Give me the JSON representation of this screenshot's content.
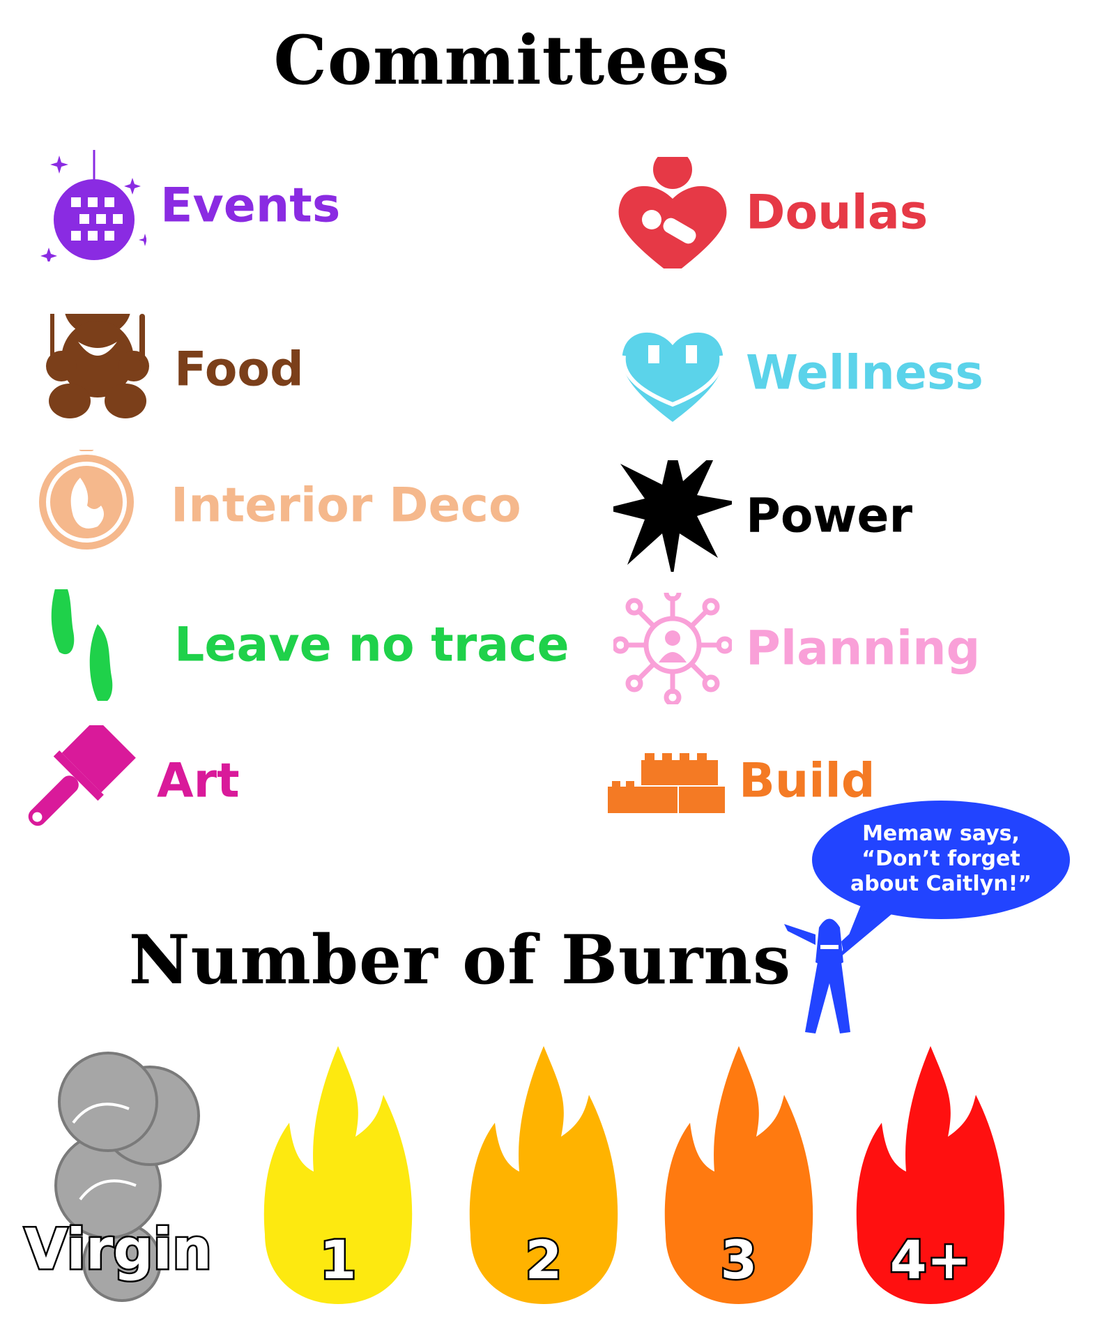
{
  "titles": {
    "committees": "Committees",
    "burns": "Number of Burns"
  },
  "committees": [
    {
      "label": "Events",
      "color": "#8a2be2",
      "icon": "disco-ball-icon"
    },
    {
      "label": "Doulas",
      "color": "#e63946",
      "icon": "heart-baby-icon"
    },
    {
      "label": "Food",
      "color": "#7b3f1a",
      "icon": "teddy-bear-icon"
    },
    {
      "label": "Wellness",
      "color": "#5bd3ea",
      "icon": "heart-mask-icon"
    },
    {
      "label": "Interior Deco",
      "color": "#f5b88c",
      "icon": "ornament-icon"
    },
    {
      "label": "Power",
      "color": "#000000",
      "icon": "burst-icon"
    },
    {
      "label": "Leave no trace",
      "color": "#1fd14a",
      "icon": "footprints-icon"
    },
    {
      "label": "Planning",
      "color": "#f9a0d8",
      "icon": "network-icon"
    },
    {
      "label": "Art",
      "color": "#d91a9a",
      "icon": "paintbrush-icon"
    },
    {
      "label": "Build",
      "color": "#f47a24",
      "icon": "bricks-icon"
    }
  ],
  "bubble": {
    "line1": "Memaw says,",
    "line2": "“Don’t forget",
    "line3": "about Caitlyn!”",
    "color": "#2244ff"
  },
  "burns": [
    {
      "label": "Virgin",
      "color": "#a6a6a6",
      "icon": "smoke-icon"
    },
    {
      "label": "1",
      "color": "#fde910",
      "icon": "flame-icon"
    },
    {
      "label": "2",
      "color": "#ffb300",
      "icon": "flame-icon"
    },
    {
      "label": "3",
      "color": "#ff7a10",
      "icon": "flame-icon"
    },
    {
      "label": "4+",
      "color": "#ff1010",
      "icon": "flame-icon"
    }
  ]
}
